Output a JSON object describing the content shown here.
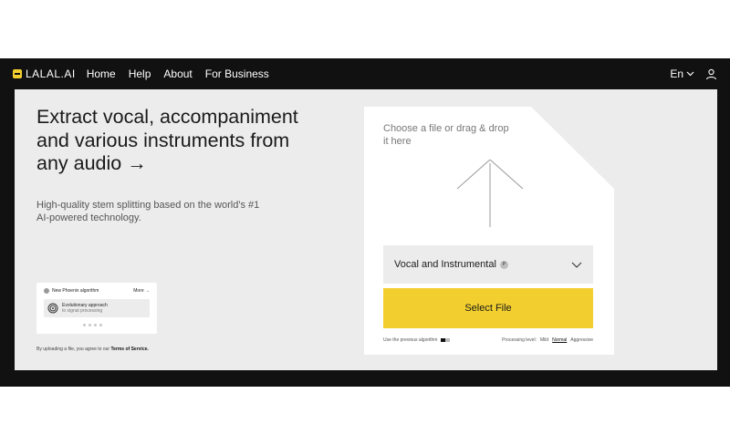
{
  "navbar": {
    "logo_text": "LALAL.AI",
    "links": [
      "Home",
      "Help",
      "About",
      "For Business"
    ],
    "language": "En"
  },
  "hero": {
    "title": "Extract vocal, accompaniment and various instruments from any audio →",
    "subtitle": "High-quality stem splitting based on the world's #1 AI-powered technology."
  },
  "promo": {
    "label": "New Phoenix algorithm",
    "more": "More →",
    "card_title": "Evolutionary approach",
    "card_subtitle": "to signal processing"
  },
  "terms": {
    "prefix": "By uploading a file, you agree to our",
    "link": "Terms of Service."
  },
  "upload": {
    "prompt": "Choose a file or drag & drop it here",
    "stem_select_value": "Vocal and Instrumental",
    "badge": "P",
    "select_file_label": "Select File",
    "previous_algorithm_label": "Use the previous algorithm",
    "processing_level_label": "Processing level:",
    "processing_levels": [
      "Mild",
      "Normal",
      "Aggressive"
    ],
    "processing_level_selected": "Normal"
  },
  "colors": {
    "accent": "#f2cf2f",
    "frame": "#111111",
    "content_bg": "#ececec"
  }
}
